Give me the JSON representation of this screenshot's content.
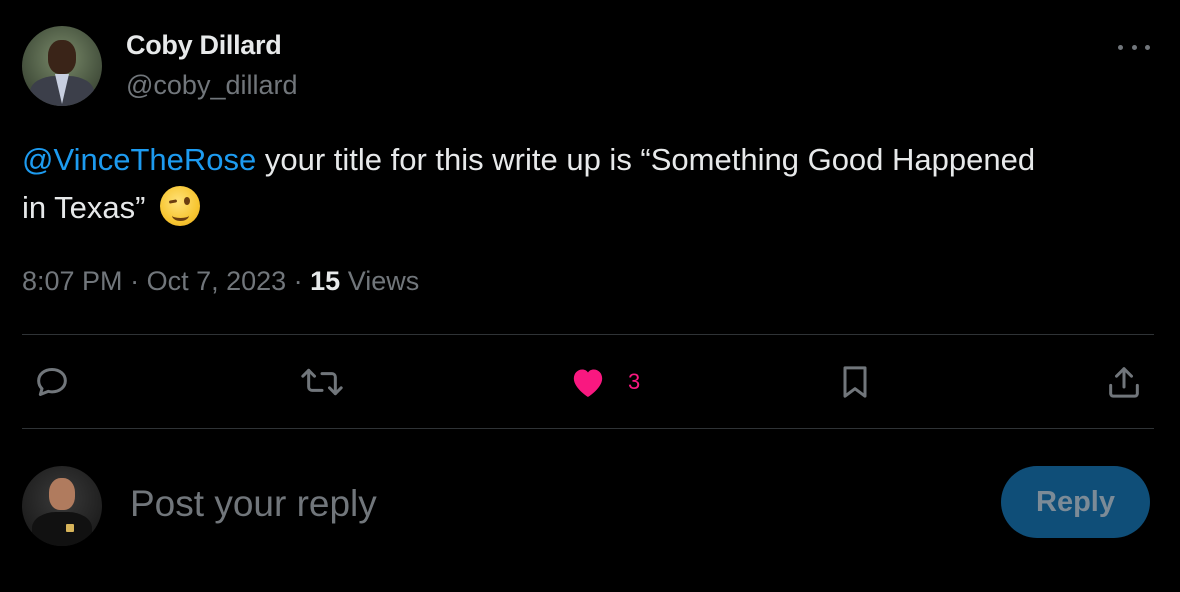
{
  "author": {
    "name": "Coby Dillard",
    "handle": "@coby_dillard"
  },
  "tweet": {
    "mention": "@VinceTheRose",
    "text_line": " your title for this write up is “Something Good Happened in Texas”",
    "emoji": "winking-face"
  },
  "meta": {
    "time": "8:07 PM",
    "separator": " · ",
    "date": "Oct 7, 2023",
    "views_count": "15",
    "views_label": " Views"
  },
  "actions": {
    "reply_icon": "comment-icon",
    "retweet_icon": "retweet-icon",
    "like_icon": "heart-icon",
    "like_count": "3",
    "bookmark_icon": "bookmark-icon",
    "share_icon": "share-icon"
  },
  "composer": {
    "placeholder": "Post your reply",
    "button_label": "Reply"
  },
  "colors": {
    "background": "#000000",
    "text_primary": "#e7e9ea",
    "text_secondary": "#71767b",
    "link": "#1d9bf0",
    "like": "#f91880",
    "reply_button_disabled": "#0f4e78"
  }
}
